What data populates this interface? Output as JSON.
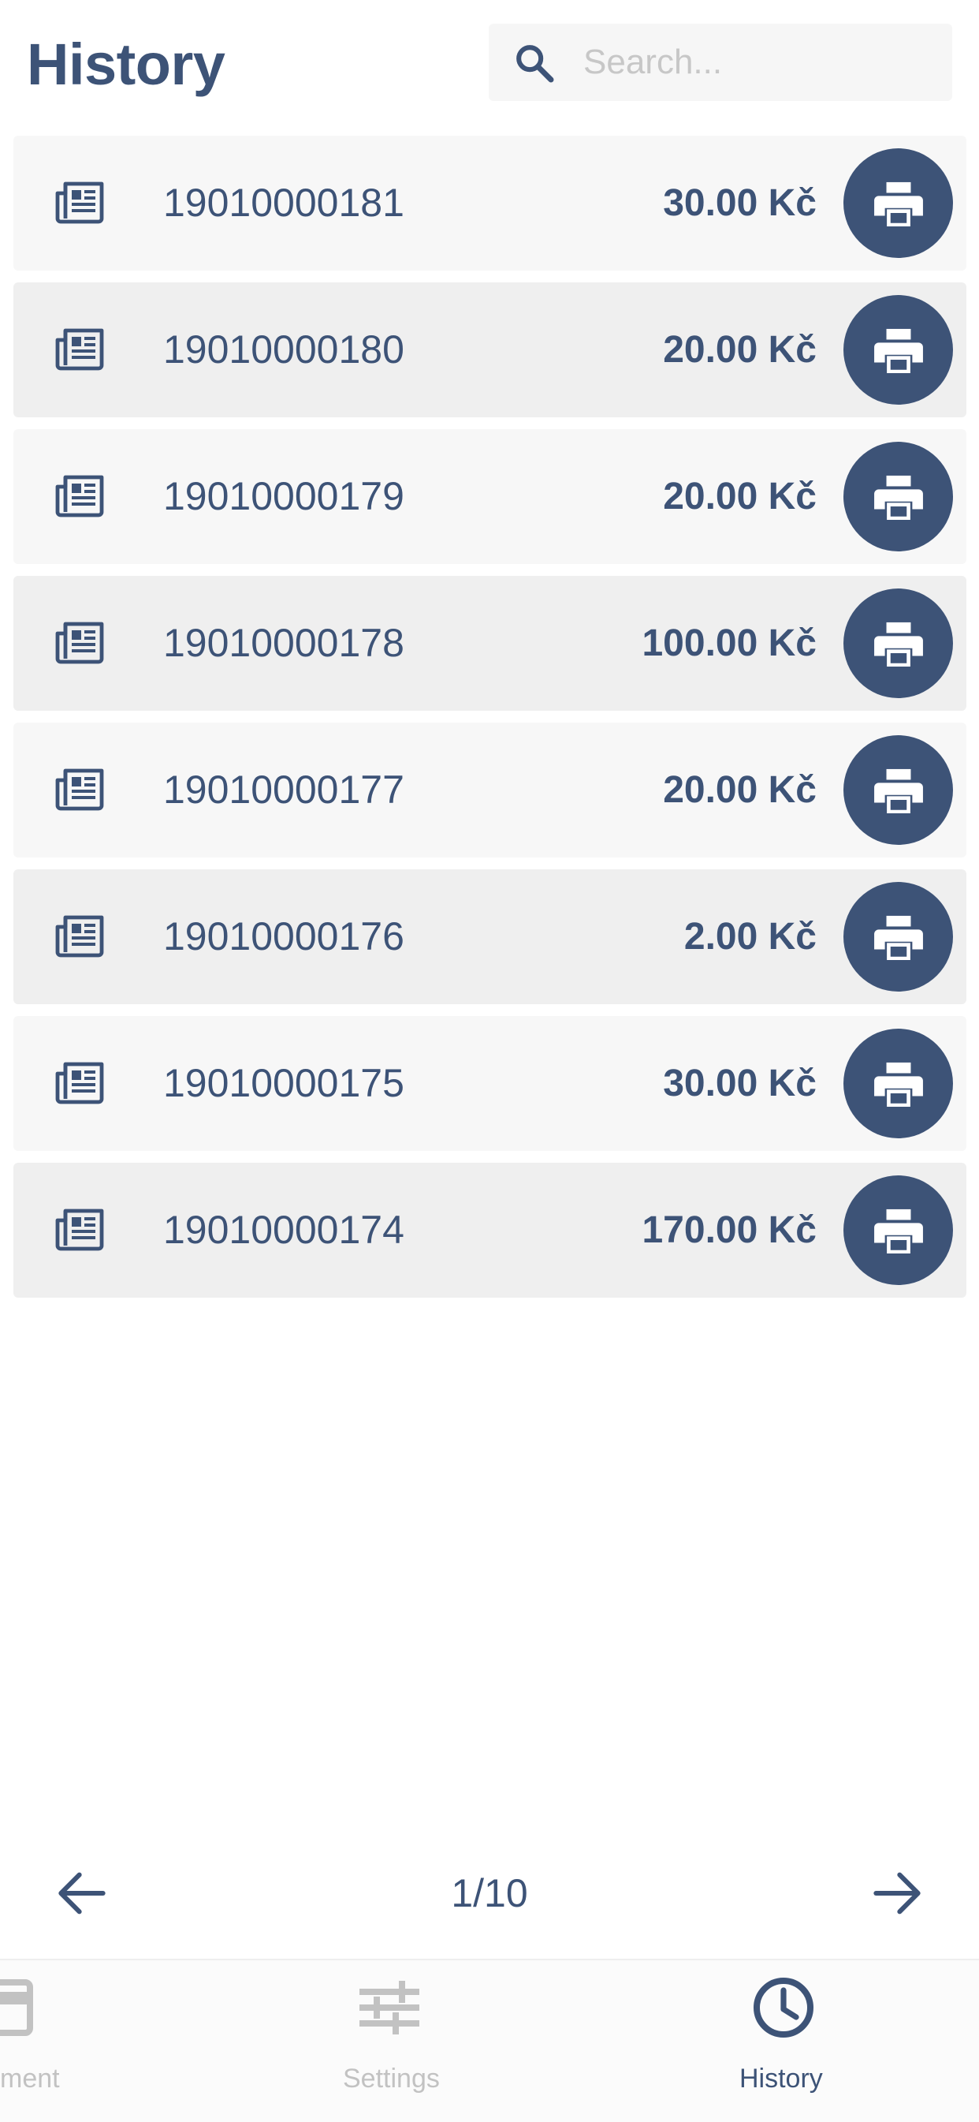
{
  "header": {
    "title": "History",
    "search": {
      "placeholder": "Search...",
      "value": "",
      "icon": "search-icon"
    }
  },
  "receipts": [
    {
      "id": "19010000181",
      "amount": "30.00 Kč"
    },
    {
      "id": "19010000180",
      "amount": "20.00 Kč"
    },
    {
      "id": "19010000179",
      "amount": "20.00 Kč"
    },
    {
      "id": "19010000178",
      "amount": "100.00 Kč"
    },
    {
      "id": "19010000177",
      "amount": "20.00 Kč"
    },
    {
      "id": "19010000176",
      "amount": "2.00 Kč"
    },
    {
      "id": "19010000175",
      "amount": "30.00 Kč"
    },
    {
      "id": "19010000174",
      "amount": "170.00 Kč"
    }
  ],
  "pagination": {
    "indicator": "1/10",
    "prev_icon": "arrow-left-icon",
    "next_icon": "arrow-right-icon"
  },
  "bottom_nav": {
    "items": [
      {
        "label": "ment",
        "icon": "payment-card-icon",
        "active": false
      },
      {
        "label": "Settings",
        "icon": "sliders-icon",
        "active": false
      },
      {
        "label": "History",
        "icon": "clock-icon",
        "active": true
      }
    ]
  },
  "colors": {
    "primary": "#3d5377",
    "row_light": "#f7f7f7",
    "row_dark": "#efefef",
    "inactive": "#c2c2c2",
    "placeholder": "#c7c7c7"
  }
}
